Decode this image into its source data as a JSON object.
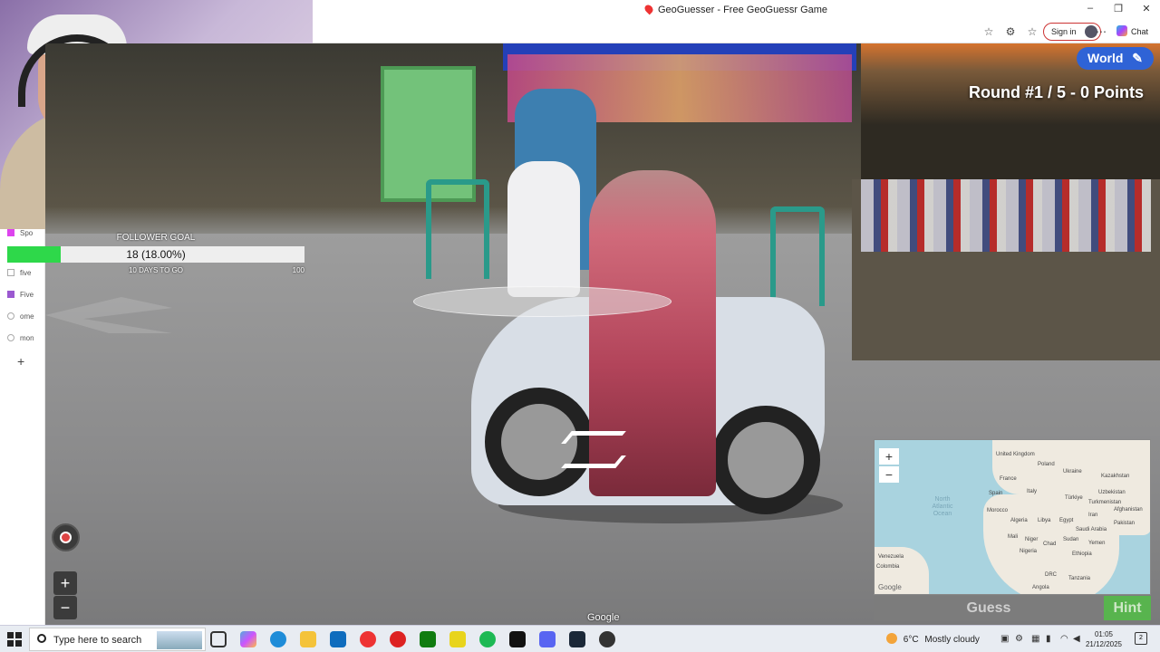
{
  "browser": {
    "tab_title": "GeoGuesser - Free GeoGuessr Game",
    "sign_in": "Sign in",
    "chat": "Chat"
  },
  "sidebar": {
    "items": [
      "Spo",
      "five",
      "Five",
      "ome",
      "mon"
    ],
    "add": "+"
  },
  "follower_goal": {
    "title": "FOLLOWER GOAL",
    "value": "18 (18.00%)",
    "progress_percent": 18,
    "days": "10 DAYS TO GO",
    "target": "100"
  },
  "game": {
    "world_button": "World",
    "round_text": "Round #1 / 5 - 0 Points",
    "zoom_in": "+",
    "zoom_out": "−",
    "google_label": "Google"
  },
  "minimap": {
    "zoom_in": "+",
    "zoom_out": "−",
    "ocean": "North Atlantic Ocean",
    "labels": {
      "united_kingdom": "United Kingdom",
      "poland": "Poland",
      "ukraine": "Ukraine",
      "kazakhstan": "Kazakhstan",
      "france": "France",
      "spain": "Spain",
      "italy": "Italy",
      "turkiye": "Türkiye",
      "uzbekistan": "Uzbekistan",
      "turkmenistan": "Turkmenistan",
      "afghanistan": "Afghanistan",
      "morocco": "Morocco",
      "algeria": "Algeria",
      "libya": "Libya",
      "egypt": "Egypt",
      "iran": "Iran",
      "saudi_arabia": "Saudi Arabia",
      "pakistan": "Pakistan",
      "mali": "Mali",
      "niger": "Niger",
      "chad": "Chad",
      "sudan": "Sudan",
      "yemen": "Yemen",
      "nigeria": "Nigeria",
      "ethiopia": "Ethiopia",
      "venezuela": "Venezuela",
      "colombia": "Colombia",
      "drc": "DRC",
      "tanzania": "Tanzania",
      "angola": "Angola",
      "google": "Google"
    },
    "guess": "Guess",
    "hint": "Hint"
  },
  "taskbar": {
    "search_placeholder": "Type here to search",
    "weather_temp": "6°C",
    "weather_desc": "Mostly cloudy",
    "time": "01:05",
    "date": "21/12/2025",
    "notification_count": "2"
  },
  "colors": {
    "accent_blue": "#2f63d6",
    "progress_green": "#2ed84a",
    "hint_green": "#58b44e"
  }
}
